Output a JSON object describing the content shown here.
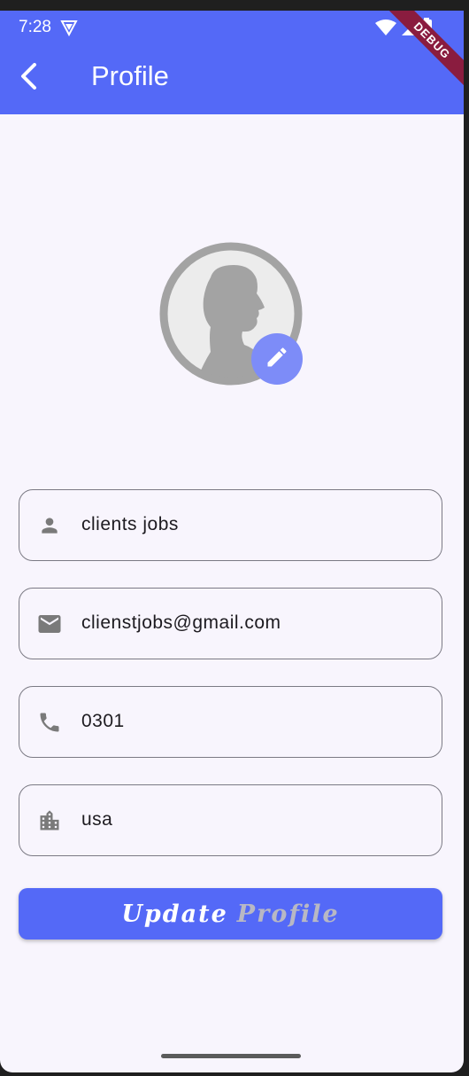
{
  "status_bar": {
    "time": "7:28",
    "debug_label": "DEBUG"
  },
  "app_bar": {
    "title": "Profile",
    "back_icon": "chevron-left-icon"
  },
  "avatar": {
    "icon": "person-silhouette-icon",
    "edit_icon": "pencil-icon"
  },
  "fields": [
    {
      "icon": "person-icon",
      "value": "clients jobs"
    },
    {
      "icon": "email-icon",
      "value": "clienstjobs@gmail.com"
    },
    {
      "icon": "phone-icon",
      "value": "0301"
    },
    {
      "icon": "location-city-icon",
      "value": "usa"
    }
  ],
  "update_button": {
    "word1": "Update",
    "word2": "Profile"
  },
  "colors": {
    "primary": "#5469f7",
    "background": "#f8f5fd",
    "icon_grey": "#7a7a7a",
    "avatar_grey": "#a3a3a3"
  }
}
